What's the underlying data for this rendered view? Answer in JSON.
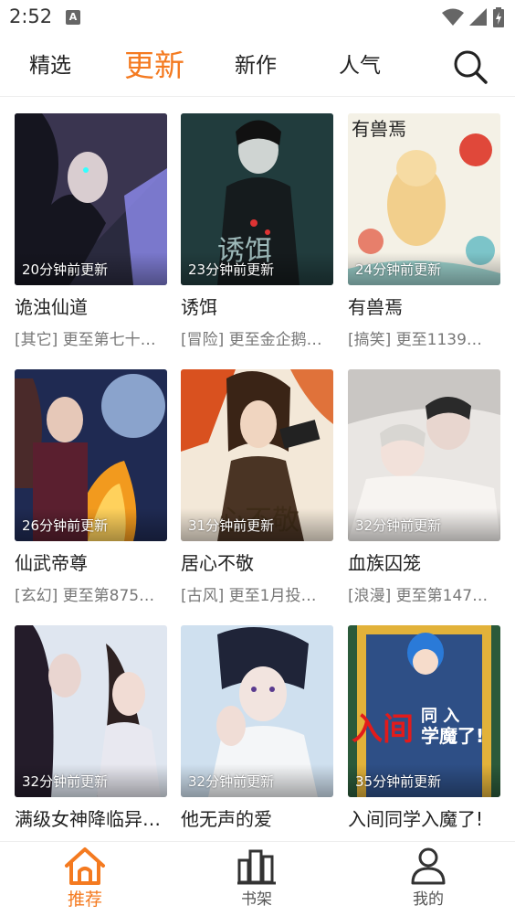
{
  "status": {
    "time": "2:52"
  },
  "top_tabs": [
    {
      "label": "精选"
    },
    {
      "label": "更新"
    },
    {
      "label": "新作"
    },
    {
      "label": "人气"
    }
  ],
  "colors": {
    "accent": "#f47a20"
  },
  "comics": [
    {
      "title": "诡浊仙道",
      "badge": "20分钟前更新",
      "subtitle": "[其它] 更至第七十…"
    },
    {
      "title": "诱饵",
      "badge": "23分钟前更新",
      "subtitle": "[冒险] 更至金企鹅…"
    },
    {
      "title": "有兽焉",
      "badge": "24分钟前更新",
      "subtitle": "[搞笑] 更至1139…"
    },
    {
      "title": "仙武帝尊",
      "badge": "26分钟前更新",
      "subtitle": "[玄幻] 更至第875…"
    },
    {
      "title": "居心不敬",
      "badge": "31分钟前更新",
      "subtitle": "[古风] 更至1月投…"
    },
    {
      "title": "血族囚笼",
      "badge": "32分钟前更新",
      "subtitle": "[浪漫] 更至第147…"
    },
    {
      "title": "满级女神降临异…",
      "badge": "32分钟前更新",
      "subtitle": ""
    },
    {
      "title": "他无声的爱",
      "badge": "32分钟前更新",
      "subtitle": ""
    },
    {
      "title": "入间同学入魔了!",
      "badge": "35分钟前更新",
      "subtitle": ""
    }
  ],
  "bottom_nav": [
    {
      "label": "推荐",
      "icon": "home-icon"
    },
    {
      "label": "书架",
      "icon": "bookshelf-icon"
    },
    {
      "label": "我的",
      "icon": "user-icon"
    }
  ]
}
